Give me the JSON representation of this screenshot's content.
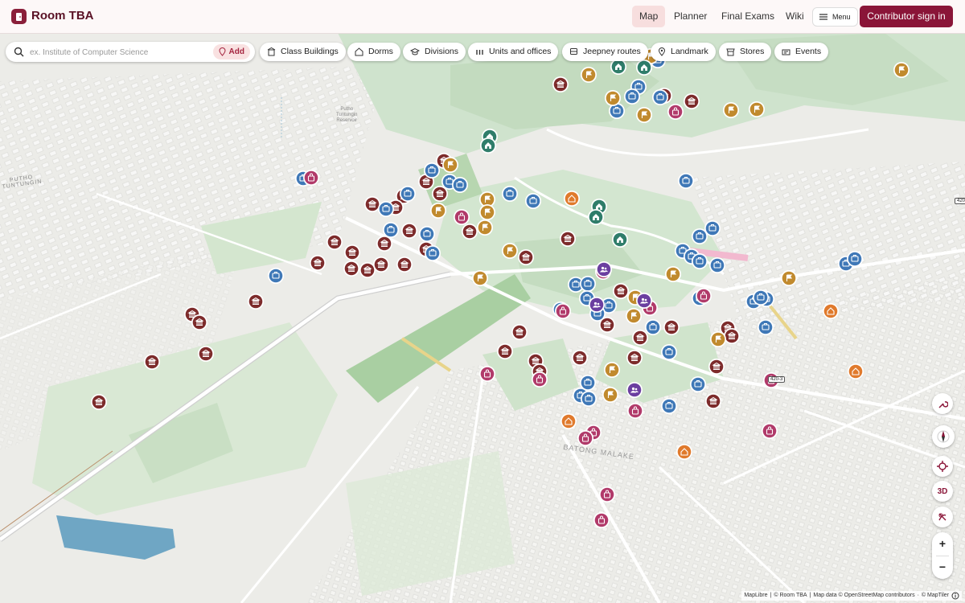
{
  "app": {
    "title": "Room TBA"
  },
  "nav": {
    "items": [
      "Map",
      "Planner",
      "Final Exams",
      "Wiki"
    ],
    "active": "Map",
    "menu_label": "Menu",
    "signin_label": "Contributor sign in"
  },
  "search": {
    "placeholder": "ex. Institute of Computer Science",
    "add_label": "Add"
  },
  "filters": [
    {
      "label": "Class Buildings",
      "icon": "building-icon"
    },
    {
      "label": "Dorms",
      "icon": "house-icon"
    },
    {
      "label": "Divisions",
      "icon": "grad-cap-icon"
    },
    {
      "label": "Units and offices",
      "icon": "bars-icon"
    },
    {
      "label": "Jeepney routes",
      "icon": "bus-icon"
    },
    {
      "label": "Landmark",
      "icon": "pin-icon"
    },
    {
      "label": "Stores",
      "icon": "store-icon"
    },
    {
      "label": "Events",
      "icon": "ticket-icon"
    }
  ],
  "map_labels": {
    "reservoir": [
      "Putho",
      "Tuntungin",
      "Reservoir"
    ],
    "area1": [
      "PUTHO",
      "TUNTUNGIN"
    ],
    "area2": "BATONG MALAKE",
    "road_badge": "420-3",
    "road_badge_edge": "420"
  },
  "controls": {
    "mode_3d": "3D",
    "zoom_in": "+",
    "zoom_out": "−"
  },
  "attribution": [
    "MapLibre",
    "© Room TBA",
    "Map data © OpenStreetMap contributors",
    "© MapTiler"
  ],
  "colors": {
    "brand": "#8a1538",
    "class_building": "#7d2b2b",
    "dorm": "#e07a2c",
    "division": "#2f7d6a",
    "unit": "#3f78b7",
    "landmark": "#c18a2e",
    "store": "#b13a6a",
    "event": "#6b3fa0"
  }
}
